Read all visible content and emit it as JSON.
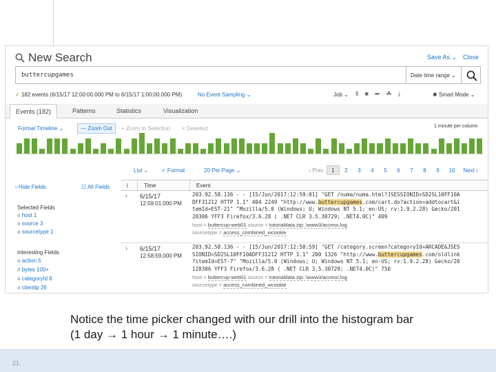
{
  "caption": {
    "line1": "Notice the time picker changed with our drill into the histogram bar",
    "line2": "(1 day → 1 hour → 1 minute….)"
  },
  "slide_number": "21",
  "app": {
    "title": "New Search",
    "save_as": "Save As ⌄",
    "close": "Close"
  },
  "search": {
    "query": "buttercupgames",
    "time_picker": "Date time range ⌄"
  },
  "status": {
    "check": "✓",
    "events": "182 events (6/15/17 12:00:00.000 PM to 6/15/17 1:00:00.000 PM)",
    "sampling": "No Event Sampling ⌄",
    "job": "Job ⌄",
    "job_icons": [
      "Ⅱ",
      "■",
      "➦",
      "☘",
      "⤓"
    ],
    "smart_mode": "✱ Smart Mode ⌄"
  },
  "tabs": [
    "Events (182)",
    "Patterns",
    "Statistics",
    "Visualization"
  ],
  "timeline": {
    "format": "Format Timeline ⌄",
    "zoom_out": "— Zoom Out",
    "zoom_selection": "+ Zoom to Selection",
    "deselect": "× Deselect",
    "per_bar": "1 minute per column"
  },
  "histogram": {
    "values": [
      2,
      3,
      3,
      1,
      3,
      3,
      3,
      1,
      2,
      3,
      1,
      2,
      1,
      3,
      1,
      3,
      4,
      2,
      3,
      2,
      3,
      1,
      2,
      2,
      1,
      2,
      3,
      2,
      3,
      3,
      2,
      2,
      2,
      4,
      2,
      2,
      3,
      2,
      1,
      3,
      1,
      3,
      2,
      1,
      2,
      3,
      2,
      2,
      3,
      2,
      2,
      3,
      2,
      2,
      1,
      3,
      2,
      3,
      2,
      3,
      3
    ],
    "max": 4,
    "color": "#65a637"
  },
  "list_controls": {
    "list": "List ⌄",
    "format": "✓ Format",
    "per_page": "20 Per Page ⌄"
  },
  "pager": {
    "prev": "‹ Prev",
    "pages": [
      "1",
      "2",
      "3",
      "4",
      "5",
      "6",
      "7",
      "8",
      "9",
      "10"
    ],
    "current": "1",
    "next": "Next ›"
  },
  "fields": {
    "hide": "‹ Hide Fields",
    "all": "☷ All Fields",
    "selected_heading": "Selected Fields",
    "selected": [
      {
        "type": "a",
        "name": "host",
        "count": "1"
      },
      {
        "type": "a",
        "name": "source",
        "count": "3"
      },
      {
        "type": "a",
        "name": "sourcetype",
        "count": "1"
      }
    ],
    "interesting_heading": "Interesting Fields",
    "interesting": [
      {
        "type": "a",
        "name": "action",
        "count": "5"
      },
      {
        "type": "#",
        "name": "bytes",
        "count": "100+"
      },
      {
        "type": "a",
        "name": "categoryId",
        "count": "8"
      },
      {
        "type": "a",
        "name": "clientip",
        "count": "26"
      }
    ]
  },
  "table": {
    "col_expand": "i",
    "col_time": "Time",
    "col_event": "Event",
    "rows": [
      {
        "expand": "›",
        "date": "6/15/17",
        "time": "12:59:01.000 PM",
        "log": [
          [
            "203.92.58.136 - - [15/Jun/2017:12:59:01] \"GET /numa/numa.html?JSESSIONID=SD2SL10FF10A",
            ""
          ],
          [
            "DFF31212 HTTP 1.1\" 404 2249 \"http://www.",
            "buttercupgames",
            ".com/cart.do?action=addtocart&i"
          ],
          [
            "temId=EST-21\" \"Mozilla/5.0 (Windows; U; Windows NT 5.1; en-US; rv:1.9.2.28) Gecko/201",
            ""
          ],
          [
            "20306 YFF3 Firefox/3.6.28 ( .NET CLR 3.5.30729; .NET4.0C)\" 409",
            ""
          ]
        ],
        "host_k": "host =",
        "host_v": "buttercup-web01",
        "source_k": "source =",
        "source_v": "tutorialdata.zip:.\\www3/access.log",
        "stype_k": "sourcetype =",
        "stype_v": "access_combined_wcookie"
      },
      {
        "expand": "›",
        "date": "6/15/17",
        "time": "12:58:59.000 PM",
        "log": [
          [
            "203.92.58.136 - - [15/Jun/2017:12:58:59] \"GET /category.screen?categoryId=ARCADE&JSES",
            ""
          ],
          [
            "SIONID=SD2SL10FF10ADFF31212 HTTP 1.1\" 200 1326 \"http://www.",
            "buttercupgames",
            ".com/oldlink"
          ],
          [
            "?itemId=EST-7\" \"Mozilla/5.0 (Windows; U; Windows NT 5.1; en-US; rv:1.9.2.28) Gecko/20",
            ""
          ],
          [
            "120306 YFF3 Firefox/3.6.28 ( .NET CLR 3.5.30729; .NET4.0C)\" 750",
            ""
          ]
        ],
        "host_k": "host =",
        "host_v": "buttercup-web01",
        "source_k": "source =",
        "source_v": "tutorialdata.zip:.\\www3/access.log",
        "stype_k": "sourcetype =",
        "stype_v": "access_combined_wcookie"
      }
    ]
  }
}
